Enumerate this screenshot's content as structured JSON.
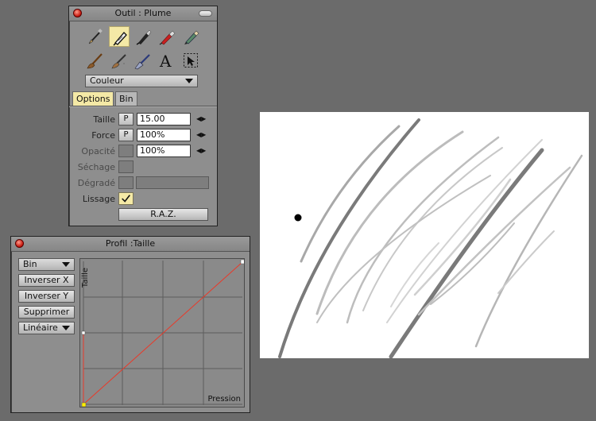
{
  "tool_window": {
    "title": "Outil : Plume",
    "tools_row1": [
      "brush-icon",
      "pen-icon",
      "ink-pen-icon",
      "marker-icon",
      "pencil-icon"
    ],
    "tools_row2": [
      "wide-brush-icon",
      "airbrush-icon",
      "flat-brush-icon",
      "text-icon",
      "selection-arrow-icon"
    ],
    "text_tool_glyph": "A",
    "color_mode": "Couleur",
    "tabs": [
      "Options",
      "Bin"
    ],
    "active_tab": "Options",
    "fields": {
      "taille": {
        "label": "Taille",
        "mode": "P",
        "value": "15.00"
      },
      "force": {
        "label": "Force",
        "mode": "P",
        "value": "100%"
      },
      "opacite": {
        "label": "Opacité",
        "value": "100%"
      },
      "sechage": {
        "label": "Séchage"
      },
      "degrade": {
        "label": "Dégradé"
      },
      "lissage": {
        "label": "Lissage",
        "checked": true
      }
    },
    "reset_label": "R.A.Z.",
    "accent_color": "#f4e9a6"
  },
  "profile_window": {
    "title": "Profil :Taille",
    "buttons": {
      "bin": "Bin",
      "invert_x": "Inverser X",
      "invert_y": "Inverser Y",
      "delete": "Supprimer",
      "mode": "Linéaire"
    },
    "y_axis_label": "Taille",
    "x_axis_label": "Pression",
    "curve_color": "#e83a2a",
    "handle_color": "#ffee00"
  },
  "canvas": {
    "background": "#ffffff",
    "stroke_colors": [
      "#7a7a7a",
      "#b4b4b4",
      "#d0d0d0"
    ]
  }
}
